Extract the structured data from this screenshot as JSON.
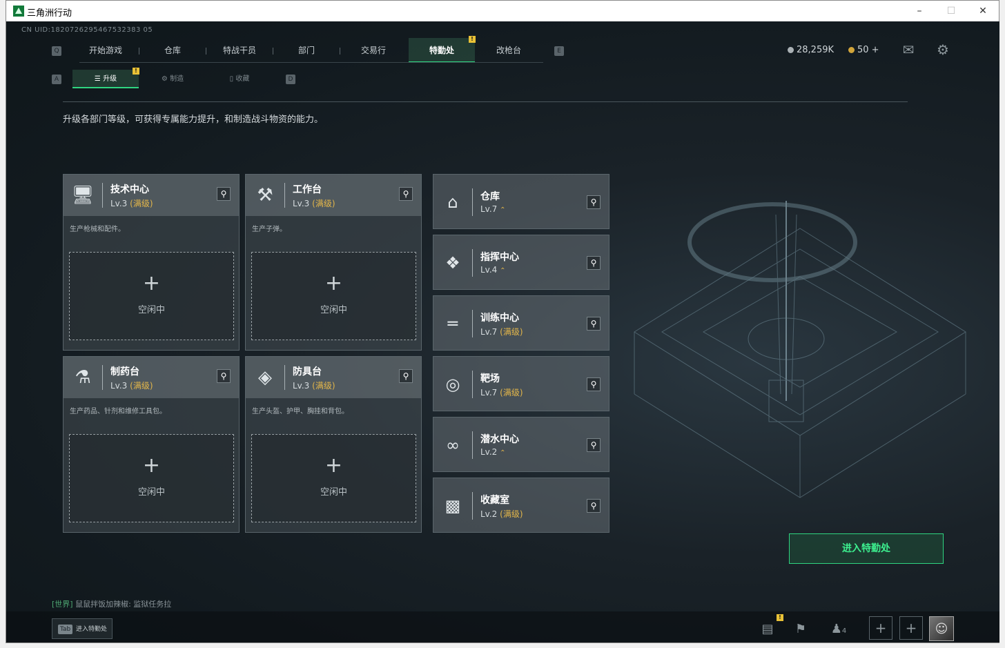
{
  "window": {
    "title": "三角洲行动"
  },
  "uid": "CN UID:1820726295467532383 05",
  "nav": {
    "q_key": "Q",
    "e_key": "E",
    "items": [
      {
        "label": "开始游戏"
      },
      {
        "label": "仓库"
      },
      {
        "label": "特战干员"
      },
      {
        "label": "部门"
      },
      {
        "label": "交易行"
      },
      {
        "label": "特勤处",
        "active": true,
        "badge": "!"
      },
      {
        "label": "改枪台"
      }
    ]
  },
  "currency": {
    "silver": "28,259K",
    "gold": "50 +"
  },
  "subtabs": {
    "a_key": "A",
    "d_key": "D",
    "items": [
      {
        "label": "升级",
        "active": true,
        "badge": "!"
      },
      {
        "label": "制造"
      },
      {
        "label": "收藏"
      }
    ]
  },
  "description": "升级各部门等级，可获得专属能力提升，和制造战斗物资的能力。",
  "workshops": [
    {
      "name": "技术中心",
      "level": "Lv.3",
      "status": "(满级)",
      "desc": "生产枪械和配件。",
      "slot": "空闲中",
      "icon": "computer-icon"
    },
    {
      "name": "工作台",
      "level": "Lv.3",
      "status": "(满级)",
      "desc": "生产子弹。",
      "slot": "空闲中",
      "icon": "tools-icon"
    },
    {
      "name": "制药台",
      "level": "Lv.3",
      "status": "(满级)",
      "desc": "生产药品、针剂和维修工具包。",
      "slot": "空闲中",
      "icon": "microscope-icon"
    },
    {
      "name": "防具台",
      "level": "Lv.3",
      "status": "(满级)",
      "desc": "生产头盔、护甲、胸挂和背包。",
      "slot": "空闲中",
      "icon": "armor-icon"
    }
  ],
  "facilities": [
    {
      "name": "仓库",
      "level": "Lv.7",
      "status": "",
      "upgradable": true,
      "icon": "warehouse-icon"
    },
    {
      "name": "指挥中心",
      "level": "Lv.4",
      "status": "",
      "upgradable": true,
      "icon": "command-icon"
    },
    {
      "name": "训练中心",
      "level": "Lv.7",
      "status": "(满级)",
      "upgradable": false,
      "icon": "dumbbell-icon"
    },
    {
      "name": "靶场",
      "level": "Lv.7",
      "status": "(满级)",
      "upgradable": false,
      "icon": "target-icon"
    },
    {
      "name": "潜水中心",
      "level": "Lv.2",
      "status": "",
      "upgradable": true,
      "icon": "diving-mask-icon"
    },
    {
      "name": "收藏室",
      "level": "Lv.2",
      "status": "(满级)",
      "upgradable": false,
      "icon": "collection-icon"
    }
  ],
  "enter_button": "进入特勤处",
  "chat": {
    "channel": "[世界]",
    "message": "鼠鼠拌饭加辣椒: 监狱任务拉"
  },
  "bottom": {
    "tab_key": "Tab",
    "tab_label": "进入特勤处",
    "friends_count": "4",
    "stats_badge": "!"
  },
  "colors": {
    "accent": "#2fd681",
    "max_level": "#e3b64a",
    "badge": "#e9c136"
  }
}
